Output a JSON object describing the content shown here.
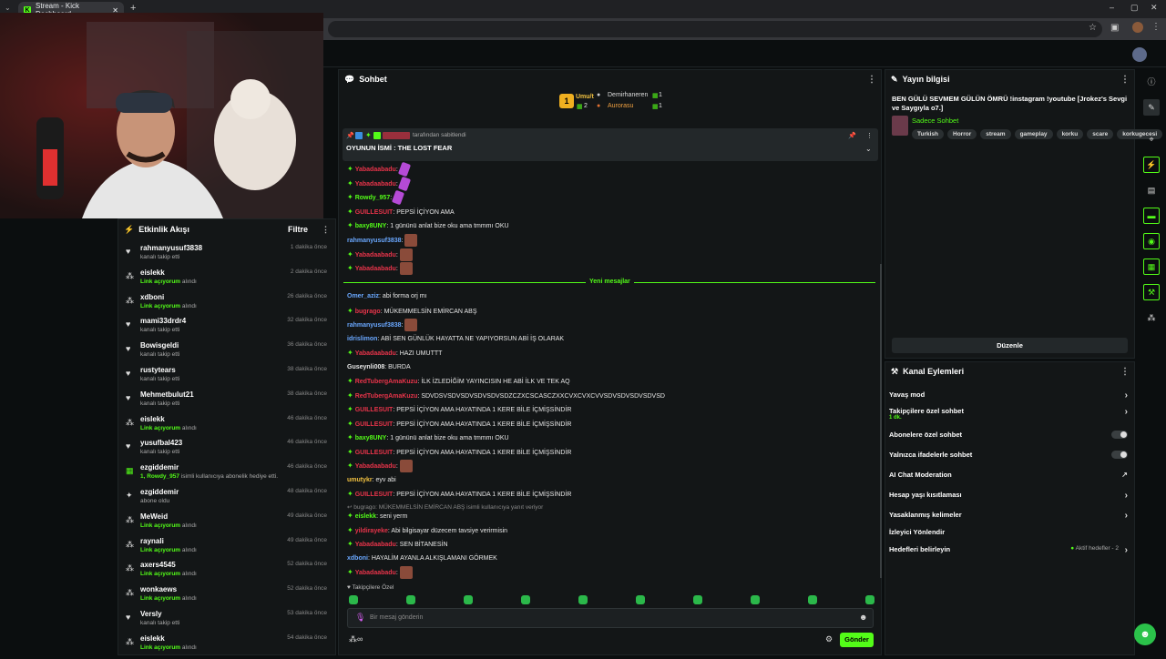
{
  "browser": {
    "tab_title": "Stream - Kick Dashboard",
    "favicon_letter": "K",
    "new_tab": "+",
    "window_controls": [
      "–",
      "▢",
      "✕"
    ]
  },
  "activity": {
    "title": "Etkinlik Akışı",
    "filter_label": "Filtre",
    "items": [
      {
        "icon": "heart-icon",
        "name": "rahmanyusuf3838",
        "sub": "kanalı takip etti",
        "sub_green": "",
        "time": "1 dakika önce"
      },
      {
        "icon": "gift-icon",
        "name": "eislekk",
        "sub": "alındı",
        "sub_green": "Link açıyorum",
        "time": "2 dakika önce"
      },
      {
        "icon": "gift-icon",
        "name": "xdboni",
        "sub": "alındı",
        "sub_green": "Link açıyorum",
        "time": "26 dakika önce"
      },
      {
        "icon": "heart-icon",
        "name": "mami33drdr4",
        "sub": "kanalı takip etti",
        "sub_green": "",
        "time": "32 dakika önce"
      },
      {
        "icon": "heart-icon",
        "name": "Bowisgeldi",
        "sub": "kanalı takip etti",
        "sub_green": "",
        "time": "36 dakika önce"
      },
      {
        "icon": "heart-icon",
        "name": "rustytears",
        "sub": "kanalı takip etti",
        "sub_green": "",
        "time": "38 dakika önce"
      },
      {
        "icon": "heart-icon",
        "name": "Mehmetbulut21",
        "sub": "kanalı takip etti",
        "sub_green": "",
        "time": "38 dakika önce"
      },
      {
        "icon": "gift-icon",
        "name": "eislekk",
        "sub": "alındı",
        "sub_green": "Link açıyorum",
        "time": "46 dakika önce"
      },
      {
        "icon": "heart-icon",
        "name": "yusufbal423",
        "sub": "kanalı takip etti",
        "sub_green": "",
        "time": "46 dakika önce"
      },
      {
        "icon": "sub-gift-icon",
        "name": "ezgiddemir",
        "sub": "isimli kullanıcıya abonelik hediye etti.",
        "sub_green": "1, Rowdy_957",
        "time": "46 dakika önce"
      },
      {
        "icon": "star-icon",
        "name": "ezgiddemir",
        "sub": "abone oldu",
        "sub_green": "",
        "time": "48 dakika önce"
      },
      {
        "icon": "gift-icon",
        "name": "MeWeid",
        "sub": "alındı",
        "sub_green": "Link açıyorum",
        "time": "49 dakika önce"
      },
      {
        "icon": "gift-icon",
        "name": "raynali",
        "sub": "alındı",
        "sub_green": "Link açıyorum",
        "time": "49 dakika önce"
      },
      {
        "icon": "gift-icon",
        "name": "axers4545",
        "sub": "alındı",
        "sub_green": "Link açıyorum",
        "time": "52 dakika önce"
      },
      {
        "icon": "gift-icon",
        "name": "wonkaews",
        "sub": "alındı",
        "sub_green": "Link açıyorum",
        "time": "52 dakika önce"
      },
      {
        "icon": "heart-icon",
        "name": "Versly",
        "sub": "kanalı takip etti",
        "sub_green": "",
        "time": "53 dakika önce"
      },
      {
        "icon": "gift-icon",
        "name": "eislekk",
        "sub": "alındı",
        "sub_green": "Link açıyorum",
        "time": "54 dakika önce"
      }
    ]
  },
  "chat": {
    "title": "Sohbet",
    "leaderboard": {
      "first": {
        "rank": "1",
        "name": "Umu/t",
        "count": "2"
      },
      "second": {
        "name": "Demirhaneren",
        "count": "1"
      },
      "third": {
        "name": "Aurorasu",
        "count": "1"
      }
    },
    "pinned_by": "tarafından sabitlendi",
    "pinned_text": "OYUNUN İSMİ : THE LOST FEAR",
    "new_messages": "Yeni mesajlar",
    "messages_before": [
      {
        "user": "Yabadaabadu",
        "color": "#e8344a",
        "text": "",
        "emote": "p"
      },
      {
        "user": "Yabadaabadu",
        "color": "#e8344a",
        "text": "",
        "emote": "p"
      },
      {
        "user": "Rowdy_957",
        "color": "#53fc18",
        "text": "",
        "emote": "p"
      },
      {
        "user": "GUILLESUIT",
        "color": "#e8344a",
        "text": "PEPSİ İÇİYON AMA",
        "emote": ""
      },
      {
        "user": "baxy8UNY",
        "color": "#53fc18",
        "text": "1 gününü anlat bize oku ama tmmmı OKU",
        "emote": ""
      },
      {
        "user": "rahmanyusuf3838",
        "color": "#6aa8ff",
        "text": "",
        "emote": "x"
      },
      {
        "user": "Yabadaabadu",
        "color": "#e8344a",
        "text": "",
        "emote": "x"
      },
      {
        "user": "Yabadaabadu",
        "color": "#e8344a",
        "text": "",
        "emote": "x"
      }
    ],
    "messages_after": [
      {
        "user": "Omer_aziz",
        "color": "#6aa8ff",
        "text": "abi forma orj mı",
        "emote": ""
      },
      {
        "user": "bugrago",
        "color": "#e8344a",
        "text": "MÜKEMMELSİN EMİRCAN ABŞ",
        "emote": ""
      },
      {
        "user": "rahmanyusuf3838",
        "color": "#6aa8ff",
        "text": "",
        "emote": "x"
      },
      {
        "user": "idrislimon",
        "color": "#6aa8ff",
        "text": "ABİ SEN GÜNLÜK HAYATTA NE YAPIYORSUN ABİ İŞ OLARAK",
        "emote": ""
      },
      {
        "user": "Yabadaabadu",
        "color": "#e8344a",
        "text": "HAZI UMUTTT",
        "emote": ""
      },
      {
        "user": "Guseynli008",
        "color": "#e6e6e6",
        "text": "BURDA",
        "emote": ""
      },
      {
        "user": "RedTubergAmaKuzu",
        "color": "#e8344a",
        "text": "İLK İZLEDİĞİM YAYINCISIN HE ABİ İLK VE TEK AQ",
        "emote": ""
      },
      {
        "user": "RedTubergAmaKuzu",
        "color": "#e8344a",
        "text": "SDVDSVSDVSDVSDVSDVSDZCZXCSCASCZXXCVXCVXCVVSDVSDVSDVSDVSD",
        "emote": ""
      },
      {
        "user": "GUILLESUIT",
        "color": "#e8344a",
        "text": "PEPSİ İÇİYON AMA HAYATINDA 1 KERE BİLE İÇMİŞSİNDİR",
        "emote": ""
      },
      {
        "user": "GUILLESUIT",
        "color": "#e8344a",
        "text": "PEPSİ İÇİYON AMA HAYATINDA 1 KERE BİLE İÇMİŞSİNDİR",
        "emote": ""
      },
      {
        "user": "baxy8UNY",
        "color": "#53fc18",
        "text": "1 gününü anlat bize oku ama tmmmı OKU",
        "emote": ""
      },
      {
        "user": "GUILLESUIT",
        "color": "#e8344a",
        "text": "PEPSİ İÇİYON AMA HAYATINDA 1 KERE BİLE İÇMİŞSİNDİR",
        "emote": ""
      },
      {
        "user": "Yabadaabadu",
        "color": "#e8344a",
        "text": "",
        "emote": "x"
      },
      {
        "user": "umutykr",
        "color": "#f0c040",
        "text": "eyv abi",
        "emote": ""
      },
      {
        "user": "GUILLESUIT",
        "color": "#e8344a",
        "text": "PEPSİ İÇİYON AMA HAYATINDA 1 KERE BİLE İÇMİŞSİNDİR",
        "emote": ""
      }
    ],
    "reply_note": "bugrago: MÜKEMMELSİN EMİRCAN ABŞ isimli kullanıcıya yanıt veriyor",
    "messages_tail": [
      {
        "user": "eislekk",
        "color": "#53fc18",
        "text": "seni yerm",
        "emote": ""
      },
      {
        "user": "yildirayeke",
        "color": "#e8344a",
        "text": "Abi bilgisayar düzecem tavsiye verirmisin",
        "emote": ""
      },
      {
        "user": "Yabadaabadu",
        "color": "#e8344a",
        "text": "SEN BİTANESİN",
        "emote": ""
      },
      {
        "user": "xdboni",
        "color": "#6aa8ff",
        "text": "HAYALİM AYANLA ALKIŞLAMANI GÖRMEK",
        "emote": ""
      },
      {
        "user": "Yabadaabadu",
        "color": "#e8344a",
        "text": "",
        "emote": "x"
      }
    ],
    "followers_only": "Takipçilere Özel",
    "input_placeholder": "Bir mesaj gönderin",
    "send_label": "Gönder"
  },
  "stream_info": {
    "title": "Yayın bilgisi",
    "stream_title": "BEN GÜLÜ SEVMEM GÜLÜN ÖMRÜ !instagram !youtube [Jrokez's Sevgi ve Saygıyla o7.]",
    "category": "Sadece Sohbet",
    "tags": [
      "Turkish",
      "Horror",
      "stream",
      "gameplay",
      "korku",
      "scare",
      "korkugecesi"
    ],
    "edit_label": "Düzenle"
  },
  "channel_actions": {
    "title": "Kanal Eylemleri",
    "slow_mode": "Yavaş mod",
    "followers_chat": "Takipçilere özel sohbet",
    "followers_chat_sub": "1 dk.",
    "subs_chat": "Abonelere özel sohbet",
    "emotes_chat": "Yalnızca ifadelerle sohbet",
    "ai_mod": "AI Chat Moderation",
    "age_restrict": "Hesap yaşı kısıtlaması",
    "banned_words": "Yasaklanmış kelimeler",
    "viewer_redirect": "İzleyici Yönlendir",
    "goals": "Hedefleri belirleyin",
    "goals_status": "Aktif hedefler - 2"
  },
  "colors": {
    "accent": "#53fc18",
    "panel": "#131617",
    "bg": "#0b0e0f"
  }
}
